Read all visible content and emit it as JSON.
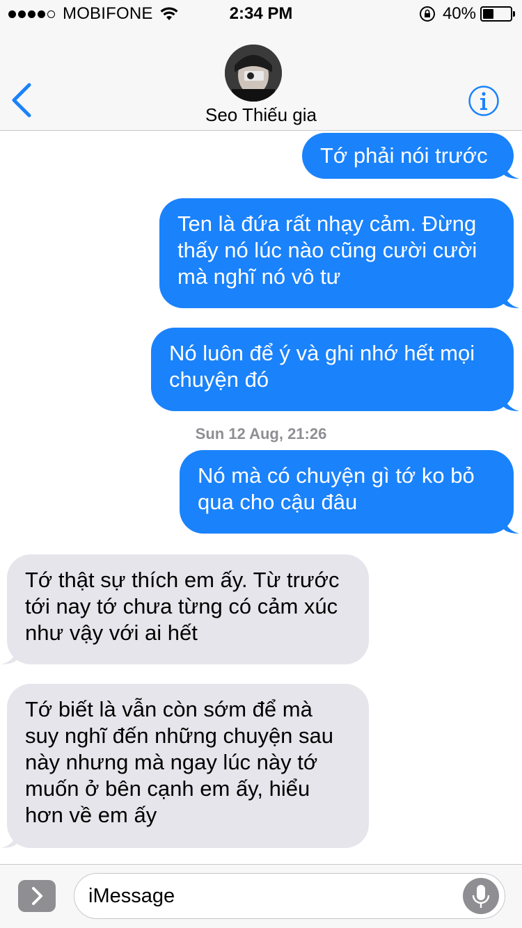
{
  "status_bar": {
    "signal_dots": "●●●●○",
    "carrier": "MOBIFONE",
    "time": "2:34 PM",
    "battery_percent": "40%",
    "battery_level": 0.4
  },
  "header": {
    "contact_name": "Seo Thiếu gia",
    "back_icon": "chevron-left-icon",
    "info_icon": "info-icon"
  },
  "messages": [
    {
      "direction": "out",
      "text": "Tớ phải nói trước"
    },
    {
      "direction": "out",
      "text": "Ten là đứa rất nhạy cảm. Đừng thấy nó lúc nào cũng cười cười mà nghĩ nó vô tư"
    },
    {
      "direction": "out",
      "text": "Nó luôn để ý và ghi nhớ hết mọi chuyện đó"
    },
    {
      "direction": "out",
      "text": "Nó mà có chuyện gì tớ ko bỏ qua cho cậu đâu"
    },
    {
      "direction": "in",
      "text": "Tớ thật sự thích em ấy. Từ trước tới nay tớ chưa từng có cảm xúc như vậy với ai hết"
    },
    {
      "direction": "in",
      "text": "Tớ biết là vẫn còn sớm để mà suy nghĩ đến những chuyện sau này nhưng mà ngay lúc này tớ muốn ở bên cạnh em ấy, hiểu hơn về em ấy"
    }
  ],
  "timestamp": "Sun 12 Aug, 21:26",
  "composer": {
    "placeholder": "iMessage"
  },
  "colors": {
    "outgoing_bubble": "#1a82fb",
    "incoming_bubble": "#e6e5eb",
    "accent": "#1a82fb"
  }
}
